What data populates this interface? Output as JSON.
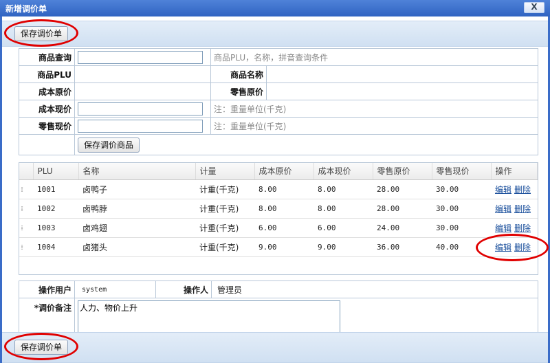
{
  "window": {
    "title": "新增调价单",
    "close_label": "X"
  },
  "toolbar": {
    "save_label": "保存调价单"
  },
  "form": {
    "query_label": "商品查询",
    "query_value": "",
    "query_hint": "商品PLU，名称，拼音查询条件",
    "plu_label": "商品PLU",
    "name_label": "商品名称",
    "cost_orig_label": "成本原价",
    "retail_orig_label": "零售原价",
    "cost_new_label": "成本现价",
    "cost_new_hint": "注：重量单位(千克)",
    "retail_new_label": "零售现价",
    "retail_new_hint": "注：重量单位(千克)",
    "save_item_label": "保存调价商品"
  },
  "grid": {
    "headers": [
      "PLU",
      "名称",
      "计量",
      "成本原价",
      "成本现价",
      "零售原价",
      "零售现价",
      "操作"
    ],
    "edit_label": "编辑",
    "delete_label": "删除",
    "rows": [
      {
        "plu": "1001",
        "name": "卤鸭子",
        "unit": "计重(千克)",
        "cost_orig": "8.00",
        "cost_new": "8.00",
        "retail_orig": "28.00",
        "retail_new": "30.00"
      },
      {
        "plu": "1002",
        "name": "卤鸭脖",
        "unit": "计重(千克)",
        "cost_orig": "8.00",
        "cost_new": "8.00",
        "retail_orig": "28.00",
        "retail_new": "30.00"
      },
      {
        "plu": "1003",
        "name": "卤鸡翅",
        "unit": "计重(千克)",
        "cost_orig": "6.00",
        "cost_new": "6.00",
        "retail_orig": "24.00",
        "retail_new": "30.00"
      },
      {
        "plu": "1004",
        "name": "卤猪头",
        "unit": "计重(千克)",
        "cost_orig": "9.00",
        "cost_new": "9.00",
        "retail_orig": "36.00",
        "retail_new": "40.00"
      }
    ]
  },
  "footer": {
    "user_label": "操作用户",
    "user_value": "system",
    "operator_label": "操作人",
    "operator_value": "管理员",
    "remark_label": "*调价备注",
    "remark_value": "人力、物价上升"
  },
  "colors": {
    "highlight": "#e00000",
    "titlebar": "#2f63c2"
  }
}
